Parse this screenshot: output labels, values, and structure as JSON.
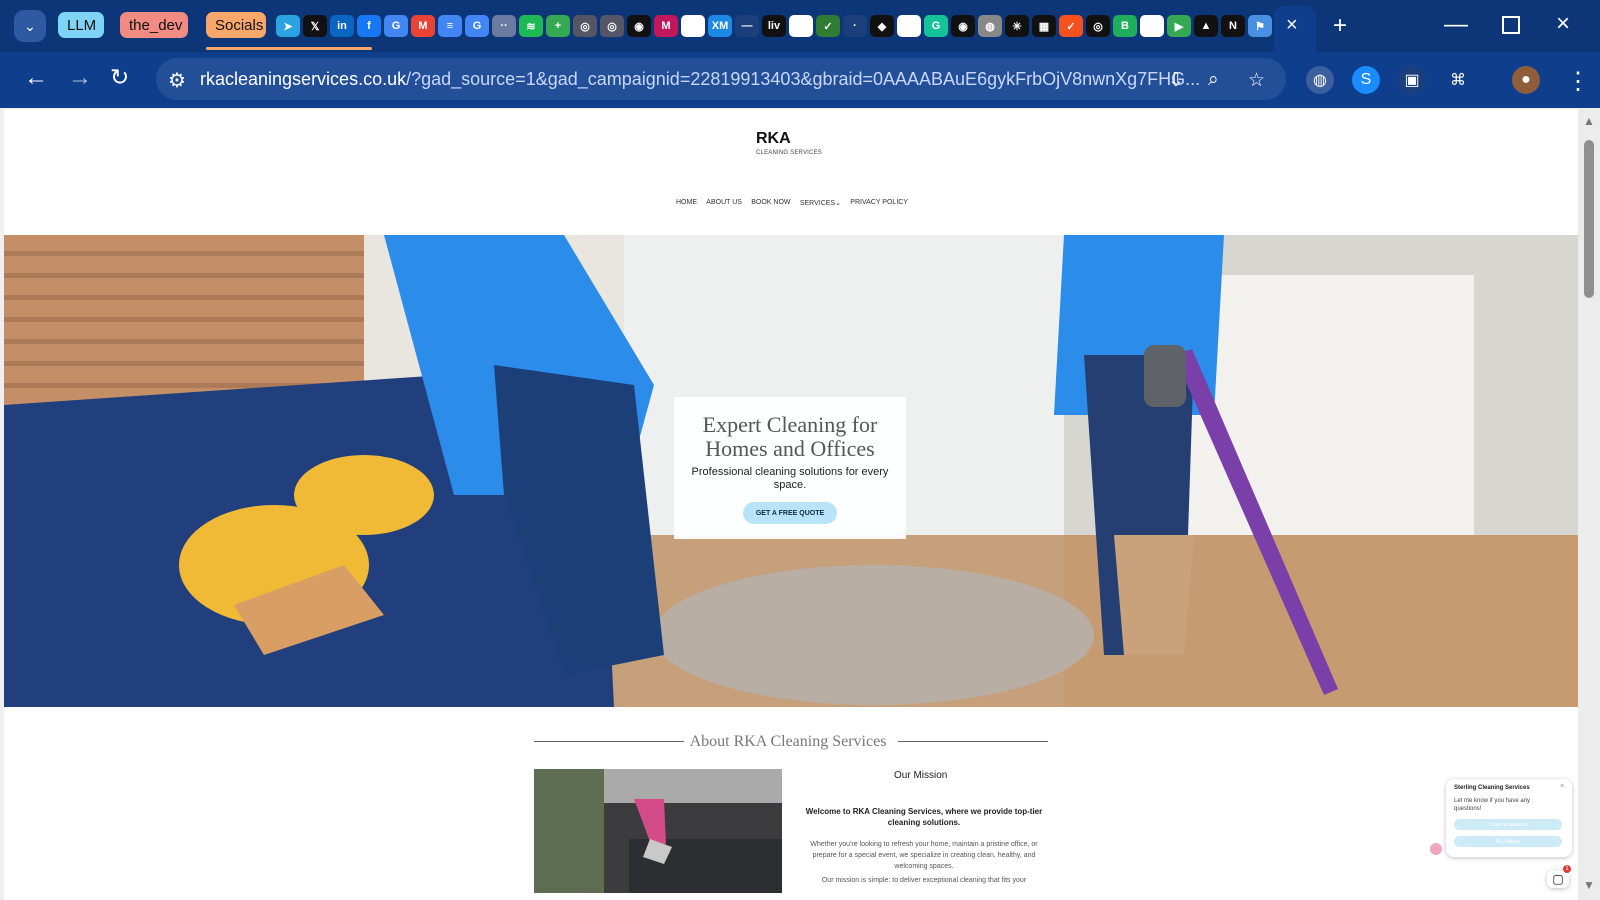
{
  "browser": {
    "tab_groups": [
      {
        "label": "LLM",
        "color": "#7fd3f6"
      },
      {
        "label": "the_dev",
        "color": "#f28b82"
      },
      {
        "label": "Socials",
        "color": "#f8a76b"
      }
    ],
    "tab_icons": [
      {
        "name": "telegram-icon",
        "glyph": "➤",
        "color": "#2aa3e0"
      },
      {
        "name": "x-icon",
        "glyph": "𝕏",
        "color": "#111"
      },
      {
        "name": "linkedin-icon",
        "glyph": "in",
        "color": "#0a66c2"
      },
      {
        "name": "facebook-icon",
        "glyph": "f",
        "color": "#1877f2"
      },
      {
        "name": "google-icon",
        "glyph": "G",
        "color": "#4285f4"
      },
      {
        "name": "gmail-icon",
        "glyph": "M",
        "color": "#ea4335"
      },
      {
        "name": "docs-icon",
        "glyph": "≡",
        "color": "#4285f4"
      },
      {
        "name": "google-icon",
        "glyph": "G",
        "color": "#4285f4"
      },
      {
        "name": "more-dots-icon",
        "glyph": "··",
        "color": "#6b7aa0"
      },
      {
        "name": "spotify-icon",
        "glyph": "≋",
        "color": "#1db954"
      },
      {
        "name": "sheets-icon",
        "glyph": "+",
        "color": "#34a853"
      },
      {
        "name": "circle-logo-icon",
        "glyph": "◎",
        "color": "#556"
      },
      {
        "name": "circle-logo-icon",
        "glyph": "◎",
        "color": "#556"
      },
      {
        "name": "github-icon",
        "glyph": "◉",
        "color": "#111"
      },
      {
        "name": "magazine-icon",
        "glyph": "M",
        "color": "#c2185b"
      },
      {
        "name": "notion-icon",
        "glyph": "N",
        "color": "#fff"
      },
      {
        "name": "xm-icon",
        "glyph": "XM",
        "color": "#1e88e5"
      },
      {
        "name": "line-icon",
        "glyph": "—",
        "color": "#1a3f7a"
      },
      {
        "name": "live-icon",
        "glyph": "liv",
        "color": "#111"
      },
      {
        "name": "openai-icon",
        "glyph": "✱",
        "color": "#fff"
      },
      {
        "name": "app-icon",
        "glyph": "✓",
        "color": "#2f7d32"
      },
      {
        "name": "tab-icon",
        "glyph": "·",
        "color": "#1a3f7a"
      },
      {
        "name": "shield-icon",
        "glyph": "◆",
        "color": "#111"
      },
      {
        "name": "wikipedia-icon",
        "glyph": "W",
        "color": "#fff"
      },
      {
        "name": "grammarly-icon",
        "glyph": "G",
        "color": "#15c39a"
      },
      {
        "name": "github-icon",
        "glyph": "◉",
        "color": "#111"
      },
      {
        "name": "globe-icon",
        "glyph": "◍",
        "color": "#888"
      },
      {
        "name": "perplexity-icon",
        "glyph": "✳",
        "color": "#111"
      },
      {
        "name": "grid-icon",
        "glyph": "▦",
        "color": "#111"
      },
      {
        "name": "check-icon",
        "glyph": "✓",
        "color": "#f4511e"
      },
      {
        "name": "target-icon",
        "glyph": "◎",
        "color": "#111"
      },
      {
        "name": "b-icon",
        "glyph": "B",
        "color": "#1fae5b"
      },
      {
        "name": "notion-icon",
        "glyph": "N",
        "color": "#fff"
      },
      {
        "name": "meet-icon",
        "glyph": "▶",
        "color": "#34a853"
      },
      {
        "name": "triangle-icon",
        "glyph": "▲",
        "color": "#111"
      },
      {
        "name": "n-icon",
        "glyph": "N",
        "color": "#111"
      },
      {
        "name": "kite-icon",
        "glyph": "⚑",
        "color": "#4a90e2"
      }
    ],
    "url_domain": "rkacleaningservices.co.uk",
    "url_path": "/?gad_source=1&gad_campaignid=22819913403&gbraid=0AAAABAuE6gykFrbOjV8nwnXg7FHG..."
  },
  "site": {
    "logo_text": "RKA",
    "logo_sub": "CLEANING SERVICES",
    "nav": [
      "HOME",
      "ABOUT US",
      "BOOK NOW",
      "SERVICES",
      "PRIVACY POLICY"
    ],
    "services_chevron": "⌄",
    "hero": {
      "title": "Expert Cleaning for Homes and Offices",
      "subtitle": "Professional cleaning solutions for every space.",
      "cta": "GET A FREE QUOTE"
    },
    "about": {
      "title": "About RKA Cleaning Services",
      "mission_heading": "Our Mission",
      "p1": "Welcome to RKA Cleaning Services, where we provide top-tier cleaning solutions.",
      "p2": "Whether you're looking to refresh your home, maintain a pristine office, or prepare for a special event, we specialize in creating clean, healthy, and welcoming spaces.",
      "p3": "Our mission is simple: to deliver exceptional cleaning that fits your"
    },
    "chat": {
      "title": "Sterling Cleaning Services",
      "message": "Let me know if you have any questions!",
      "button_question": "I have a question",
      "button_no": "No, thanks",
      "badge": "1"
    }
  }
}
